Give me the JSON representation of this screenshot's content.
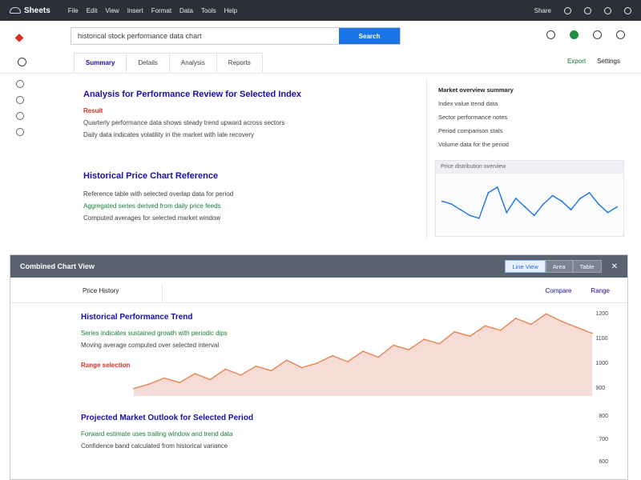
{
  "topbar": {
    "logo": "Sheets",
    "menu": [
      "File",
      "Edit",
      "View",
      "Insert",
      "Format",
      "Data",
      "Tools",
      "Help"
    ],
    "right_label": "Share"
  },
  "search": {
    "value": "historical stock performance data chart",
    "placeholder": "Search",
    "button_label": "Search"
  },
  "tabs": [
    {
      "label": "Summary"
    },
    {
      "label": "Details"
    },
    {
      "label": "Analysis"
    },
    {
      "label": "Reports"
    }
  ],
  "tab_links": [
    "Export",
    "Settings"
  ],
  "results": [
    {
      "title": "Analysis for Performance Review for Selected Index",
      "badge": "Result",
      "line1": "Quarterly performance data shows steady trend upward across sectors",
      "line2": "Daily data indicates volatility in the market with late recovery"
    },
    {
      "title": "Historical Price Chart Reference",
      "line1": "Reference table with selected overlap data for period",
      "line2": "Aggregated series derived from daily price feeds",
      "line3": "Computed averages for selected market window"
    }
  ],
  "panel": {
    "lines": [
      "Market overview summary",
      "Index value trend data",
      "Sector performance notes",
      "Period comparison stats",
      "Volume data for the period"
    ],
    "mini_title": "Price distribution overview"
  },
  "bottom": {
    "title": "Combined Chart View",
    "buttons": [
      "Line View",
      "Area",
      "Table"
    ],
    "sub_left": "Price History",
    "sub_right": [
      "Compare",
      "Range"
    ],
    "results": [
      {
        "title": "Historical Performance Trend",
        "line1": "Series indicates sustained growth with periodic dips",
        "line2": "Moving average computed over selected interval",
        "red": "Range selection"
      },
      {
        "title": "Projected Market Outlook for Selected Period",
        "line1": "Forward estimate uses trailing window and trend data",
        "line2": "Confidence band calculated from historical variance"
      }
    ],
    "axis_top": [
      "1200",
      "1100",
      "1000",
      "900"
    ],
    "axis_bottom": [
      "800",
      "700",
      "600"
    ]
  },
  "chart_data": [
    {
      "type": "line",
      "title": "",
      "x": [
        0,
        1,
        2,
        3,
        4,
        5,
        6,
        7,
        8,
        9,
        10,
        11,
        12,
        13,
        14,
        15,
        16,
        17,
        18,
        19,
        20,
        21,
        22,
        23,
        24,
        25,
        26,
        27,
        28,
        29,
        30
      ],
      "values": [
        5,
        8,
        12,
        9,
        15,
        11,
        18,
        14,
        20,
        17,
        24,
        19,
        22,
        27,
        23,
        30,
        26,
        34,
        31,
        38,
        35,
        43,
        40,
        47,
        44,
        52,
        48,
        55,
        50,
        46,
        42
      ],
      "ylim": [
        0,
        60
      ],
      "grid": false,
      "colors": {
        "line": "#e8844f",
        "fill": "#f5dcd6"
      }
    },
    {
      "type": "line",
      "title": "",
      "x": [
        0,
        1,
        2,
        3,
        4,
        5,
        6,
        7,
        8,
        9,
        10,
        11,
        12,
        13,
        14,
        15,
        16,
        17,
        18,
        19
      ],
      "values": [
        20,
        18,
        14,
        10,
        8,
        26,
        30,
        12,
        22,
        16,
        10,
        18,
        24,
        20,
        14,
        22,
        26,
        18,
        12,
        16
      ],
      "ylim": [
        0,
        35
      ],
      "grid": false,
      "colors": {
        "line": "#1a73e8"
      }
    }
  ]
}
